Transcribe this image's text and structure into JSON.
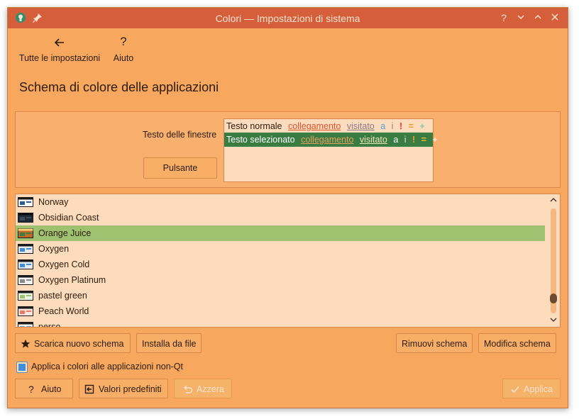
{
  "window": {
    "title": "Colori — Impostazioni di sistema",
    "controls": [
      "?",
      "⌄",
      "⌃",
      "×"
    ]
  },
  "nav": {
    "back_label": "Tutte le impostazioni",
    "help_label": "Aiuto",
    "back_icon": "arrow-left-icon",
    "help_icon": "question-icon"
  },
  "page": {
    "title": "Schema di colore delle applicazioni"
  },
  "preview": {
    "window_text_label": "Testo delle finestre",
    "button_label": "Pulsante",
    "normal": {
      "text": "Testo normale",
      "link": "collegamento",
      "visited": "visitato",
      "active": "a",
      "inactive": "i",
      "negative": "!",
      "neutral": "=",
      "positive": "+"
    },
    "selected": {
      "text": "Testo selezionato",
      "link": "collegamento",
      "visited": "visitato",
      "active": "a",
      "inactive": "i",
      "negative": "!",
      "neutral": "=",
      "positive": "+"
    }
  },
  "schemes": [
    {
      "name": "Norway",
      "selected": false
    },
    {
      "name": "Obsidian Coast",
      "selected": false
    },
    {
      "name": "Orange Juice",
      "selected": true
    },
    {
      "name": "Oxygen",
      "selected": false
    },
    {
      "name": "Oxygen Cold",
      "selected": false
    },
    {
      "name": "Oxygen Platinum",
      "selected": false
    },
    {
      "name": "pastel green",
      "selected": false
    },
    {
      "name": "Peach World",
      "selected": false
    },
    {
      "name": "perso",
      "selected": false
    }
  ],
  "actions": {
    "download": "Scarica nuovo schema",
    "install": "Installa da file",
    "remove": "Rimuovi schema",
    "edit": "Modifica schema"
  },
  "option": {
    "apply_non_qt": "Applica i colori alle applicazioni non-Qt",
    "checked": true
  },
  "footer": {
    "help": "Aiuto",
    "defaults": "Valori predefiniti",
    "reset": "Azzera",
    "apply": "Applica"
  },
  "colors": {
    "window_bg": "#f8a75e",
    "title_bg": "#d45f3a",
    "panel_bg": "#f9b06e",
    "view_bg": "#fddcbd",
    "button_bg": "#f9ae68",
    "selection_bg": "#3a7d43",
    "list_selection_bg": "#9fc271"
  }
}
